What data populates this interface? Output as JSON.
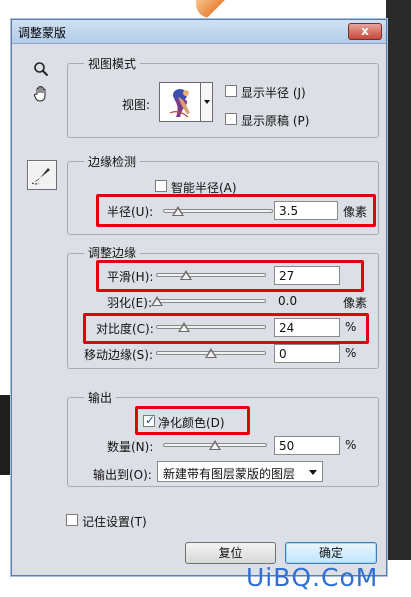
{
  "dialog": {
    "title": "调整蒙版",
    "close_glyph": "x"
  },
  "tools": {
    "zoom_icon": "magnifier-icon",
    "hand_icon": "hand-icon",
    "brush_icon": "refine-radius-brush-icon"
  },
  "view_mode": {
    "legend": "视图模式",
    "view_label": "视图:",
    "show_radius_label": "显示半径 (J)",
    "show_radius_checked": false,
    "show_original_label": "显示原稿 (P)",
    "show_original_checked": false
  },
  "edge_detection": {
    "legend": "边缘检测",
    "smart_radius_label": "智能半径(A)",
    "smart_radius_checked": false,
    "radius_label": "半径(U):",
    "radius_value": "3.5",
    "radius_unit": "像素",
    "radius_slider_fraction": 0.15
  },
  "adjust_edge": {
    "legend": "调整边缘",
    "sliders": [
      {
        "label": "平滑(H):",
        "value": "27",
        "unit": "",
        "fraction": 0.27
      },
      {
        "label": "羽化(E):",
        "value": "0.0",
        "unit": "像素",
        "fraction": 0.0
      },
      {
        "label": "对比度(C):",
        "value": "24",
        "unit": "%",
        "fraction": 0.24
      },
      {
        "label": "移动边缘(S):",
        "value": "0",
        "unit": "%",
        "fraction": 0.5
      }
    ]
  },
  "output": {
    "legend": "输出",
    "decontaminate_label": "净化颜色(D)",
    "decontaminate_checked": true,
    "amount_label": "数量(N):",
    "amount_value": "50",
    "amount_unit": "%",
    "amount_fraction": 0.5,
    "output_to_label": "输出到(O):",
    "output_to_value": "新建带有图层蒙版的图层"
  },
  "remember_settings": {
    "label": "记住设置(T)",
    "checked": false
  },
  "buttons": {
    "reset": "复位",
    "ok": "确定"
  },
  "watermark": "UiBQ.CoM",
  "colors": {
    "highlight": "#e3000f",
    "watermark": "#2f6fd6",
    "title_bar": "#c4d8ee"
  }
}
